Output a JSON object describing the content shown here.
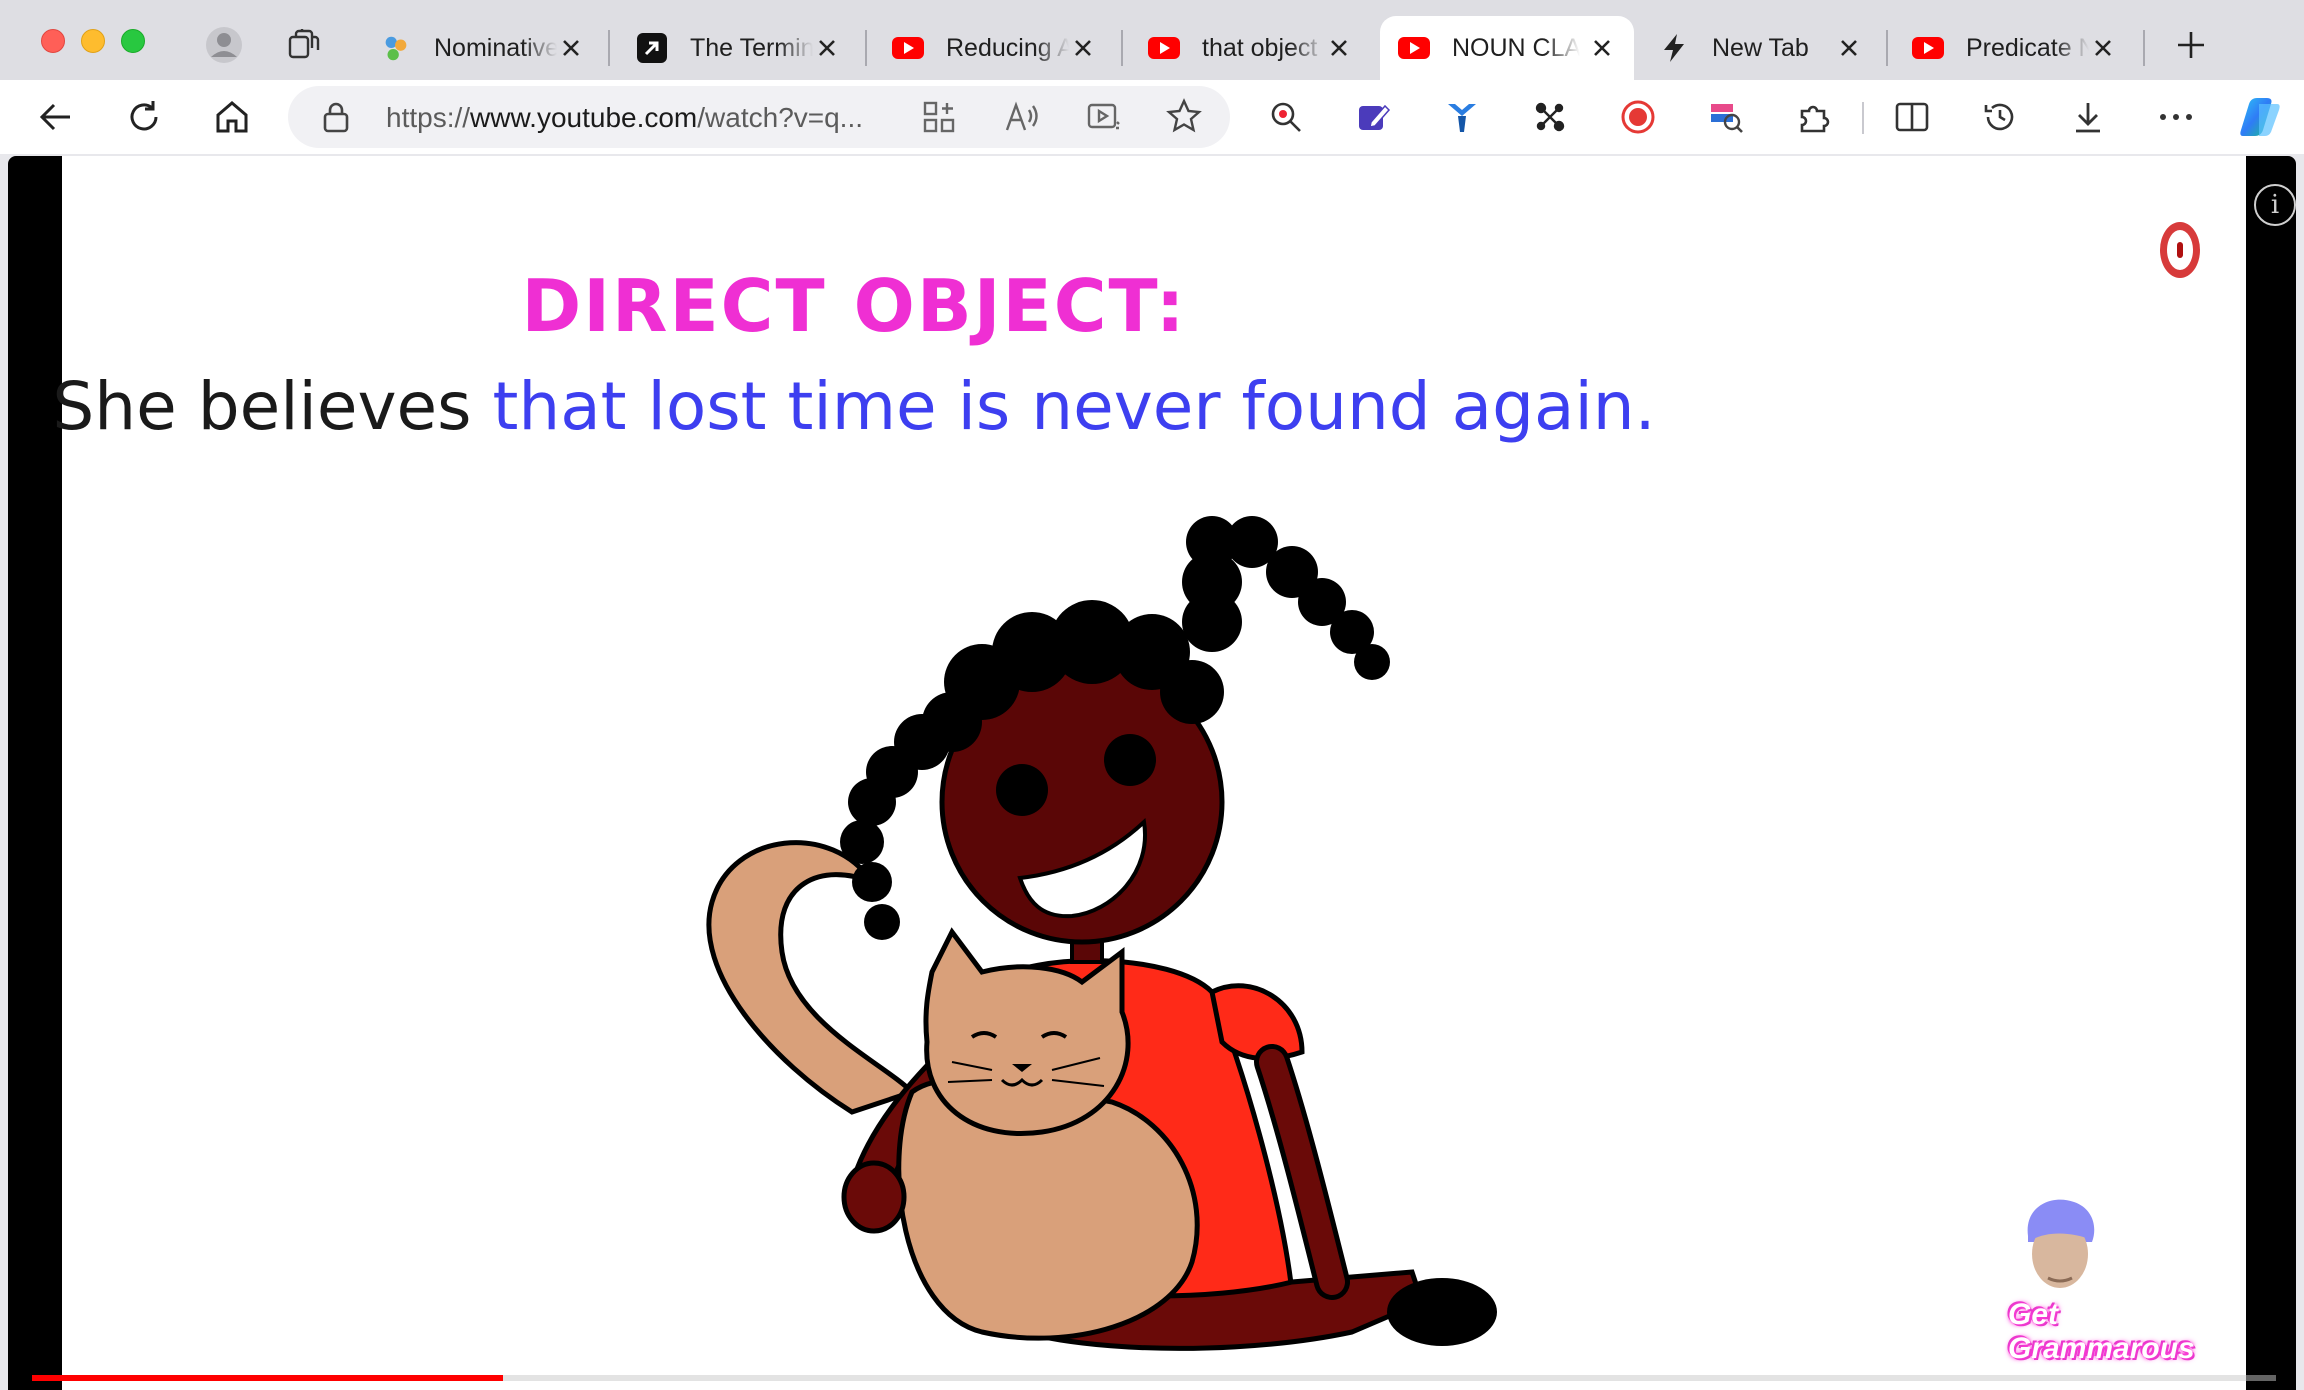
{
  "browser": {
    "tabs": [
      {
        "title": "Nominative",
        "icon": "people-icon",
        "active": false
      },
      {
        "title": "The Termin",
        "icon": "arrow-up-right-icon",
        "active": false
      },
      {
        "title": "Reducing A",
        "icon": "youtube-icon",
        "active": false
      },
      {
        "title": "that object",
        "icon": "youtube-icon",
        "active": false
      },
      {
        "title": "NOUN CLA",
        "icon": "youtube-icon",
        "active": true
      },
      {
        "title": "New Tab",
        "icon": "lightning-icon",
        "active": false
      },
      {
        "title": "Predicate N",
        "icon": "youtube-icon",
        "active": false
      }
    ],
    "address": {
      "scheme": "https://",
      "host": "www.youtube.com",
      "path": "/watch?v=q..."
    },
    "extensions": [
      "ext-search-icon",
      "ext-pen-icon",
      "ext-y-icon",
      "ext-graph-icon",
      "ext-record-icon",
      "ext-flag-icon"
    ],
    "accent": "#0f6cbd"
  },
  "video": {
    "heading": "DIRECT OBJECT:",
    "sentence_subject": "She believes",
    "sentence_clause": "that lost time is never found again.",
    "heading_color": "#ef2fd3",
    "clause_color": "#3d3ff0",
    "watermark": "Get Grammarous",
    "progress_fraction": 0.21
  }
}
